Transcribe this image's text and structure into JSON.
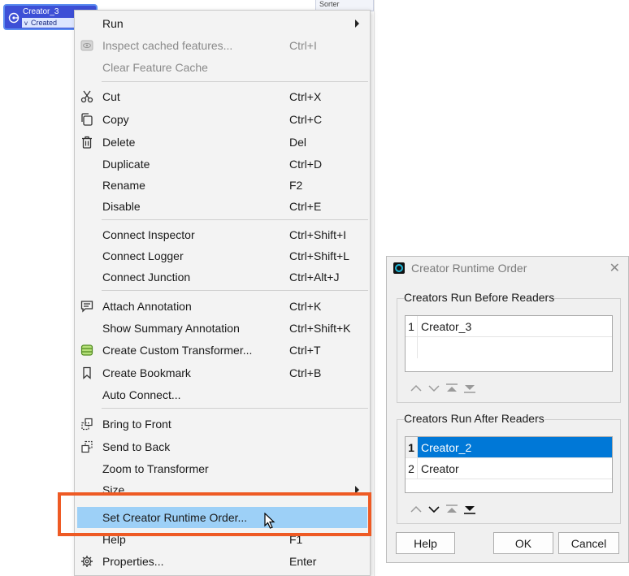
{
  "canvas": {
    "node": {
      "name": "Creator_3",
      "port_label": "Created"
    },
    "partial_node_label": "Sorter"
  },
  "context_menu": {
    "items": [
      {
        "label": "Run",
        "shortcut": "",
        "submenu": true,
        "disabled": false
      },
      {
        "label": "Inspect cached features...",
        "shortcut": "Ctrl+I",
        "disabled": true,
        "icon": "eye-cache-icon"
      },
      {
        "label": "Clear Feature Cache",
        "shortcut": "",
        "disabled": true
      },
      {
        "label": "Cut",
        "shortcut": "Ctrl+X",
        "icon": "scissors-icon"
      },
      {
        "label": "Copy",
        "shortcut": "Ctrl+C",
        "icon": "copy-icon"
      },
      {
        "label": "Delete",
        "shortcut": "Del",
        "icon": "trash-icon"
      },
      {
        "label": "Duplicate",
        "shortcut": "Ctrl+D"
      },
      {
        "label": "Rename",
        "shortcut": "F2"
      },
      {
        "label": "Disable",
        "shortcut": "Ctrl+E"
      },
      {
        "label": "Connect Inspector",
        "shortcut": "Ctrl+Shift+I"
      },
      {
        "label": "Connect Logger",
        "shortcut": "Ctrl+Shift+L"
      },
      {
        "label": "Connect Junction",
        "shortcut": "Ctrl+Alt+J"
      },
      {
        "label": "Attach Annotation",
        "shortcut": "Ctrl+K",
        "icon": "annotation-icon"
      },
      {
        "label": "Show Summary Annotation",
        "shortcut": "Ctrl+Shift+K"
      },
      {
        "label": "Create Custom Transformer...",
        "shortcut": "Ctrl+T",
        "icon": "custom-transformer-icon"
      },
      {
        "label": "Create Bookmark",
        "shortcut": "Ctrl+B",
        "icon": "bookmark-icon"
      },
      {
        "label": "Auto Connect...",
        "shortcut": ""
      },
      {
        "label": "Bring to Front",
        "shortcut": "",
        "icon": "bring-front-icon"
      },
      {
        "label": "Send to Back",
        "shortcut": "",
        "icon": "send-back-icon"
      },
      {
        "label": "Zoom to Transformer",
        "shortcut": ""
      },
      {
        "label": "Size",
        "shortcut": "",
        "submenu": true
      },
      {
        "label": "Set Creator Runtime Order...",
        "shortcut": "",
        "highlighted": true
      },
      {
        "label": "Help",
        "shortcut": "F1"
      },
      {
        "label": "Properties...",
        "shortcut": "Enter",
        "icon": "gear-icon"
      }
    ]
  },
  "dialog": {
    "title": "Creator Runtime Order",
    "before_group": {
      "label": "Creators Run Before Readers",
      "rows": [
        {
          "num": "1",
          "name": "Creator_3"
        }
      ]
    },
    "after_group": {
      "label": "Creators Run After Readers",
      "rows": [
        {
          "num": "1",
          "name": "Creator_2",
          "selected": true
        },
        {
          "num": "2",
          "name": "Creator"
        }
      ]
    },
    "buttons": {
      "help": "Help",
      "ok": "OK",
      "cancel": "Cancel"
    }
  },
  "colors": {
    "highlight": "#9dd0f7",
    "selection": "#0078d7",
    "callout": "#ee5a24",
    "node": "#3d4fd6"
  }
}
